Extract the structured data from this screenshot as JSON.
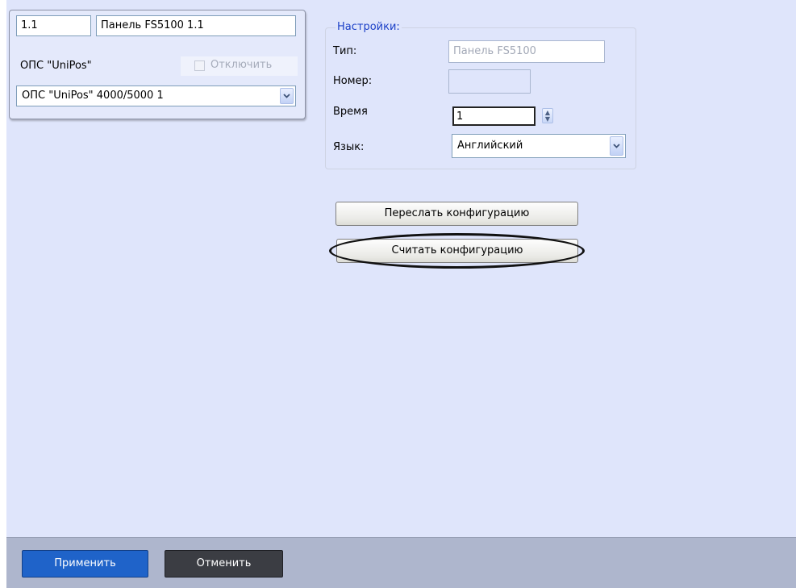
{
  "device": {
    "id_value": "1.1",
    "name_value": "Панель FS5100 1.1",
    "parent_label": "ОПС \"UniPos\"",
    "disable_label": "Отключить",
    "parent_select": "ОПС \"UniPos\" 4000/5000 1"
  },
  "settings": {
    "group_title": "Настройки:",
    "type_label": "Тип:",
    "type_value": "Панель FS5100",
    "number_label": "Номер:",
    "number_value": "",
    "time_label": "Время",
    "time_value": "1",
    "language_label": "Язык:",
    "language_value": "Английский"
  },
  "actions": {
    "send_config_label": "Переслать конфигурацию",
    "read_config_label": "Считать конфигурацию"
  },
  "footer": {
    "apply_label": "Применить",
    "cancel_label": "Отменить"
  },
  "colors": {
    "panel_bg": "#dfe5fb",
    "footer_bg": "#aeb6cd",
    "group_title": "#1a3fc7",
    "apply_button": "#1f63c9",
    "cancel_button": "#3b3d43"
  },
  "icons": {
    "dropdown": "chevron-down-icon",
    "spinner": "spin-arrows-icon"
  }
}
